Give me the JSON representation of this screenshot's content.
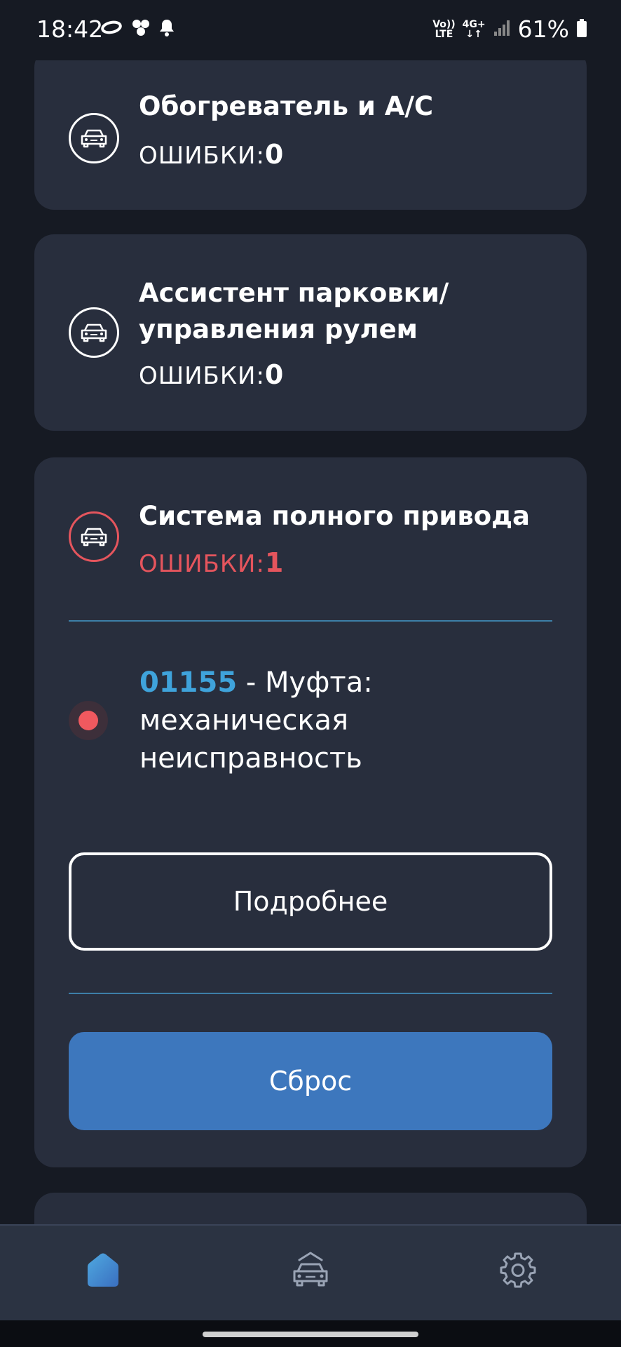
{
  "status_bar": {
    "time": "18:42",
    "network_top": "Vo))",
    "network_bottom": "LTE",
    "network_type": "4G+",
    "battery": "61%"
  },
  "cards": [
    {
      "title": "Обогреватель и A/C",
      "errors_label": "ОШИБКИ:",
      "errors_count": "0",
      "icon": "car-icon"
    },
    {
      "title": "Ассистент парковки/ управления рулем",
      "errors_label": "ОШИБКИ:",
      "errors_count": "0",
      "icon": "car-icon"
    },
    {
      "title": "Система полного привода",
      "errors_label": "ОШИБКИ:",
      "errors_count": "1",
      "icon": "car-icon",
      "fault": {
        "code": "01155",
        "description": " - Муфта: механическая неисправность"
      },
      "details_button": "Подробнее",
      "reset_button": "Сброс"
    }
  ],
  "colors": {
    "background": "#161a23",
    "card": "#282e3d",
    "error": "#e5555d",
    "accent_blue": "#3d77bd",
    "code_blue": "#3fa3db"
  },
  "bottom_nav": {
    "items": [
      {
        "icon": "home-icon",
        "active": true
      },
      {
        "icon": "car-icon",
        "active": false
      },
      {
        "icon": "gear-icon",
        "active": false
      }
    ]
  }
}
